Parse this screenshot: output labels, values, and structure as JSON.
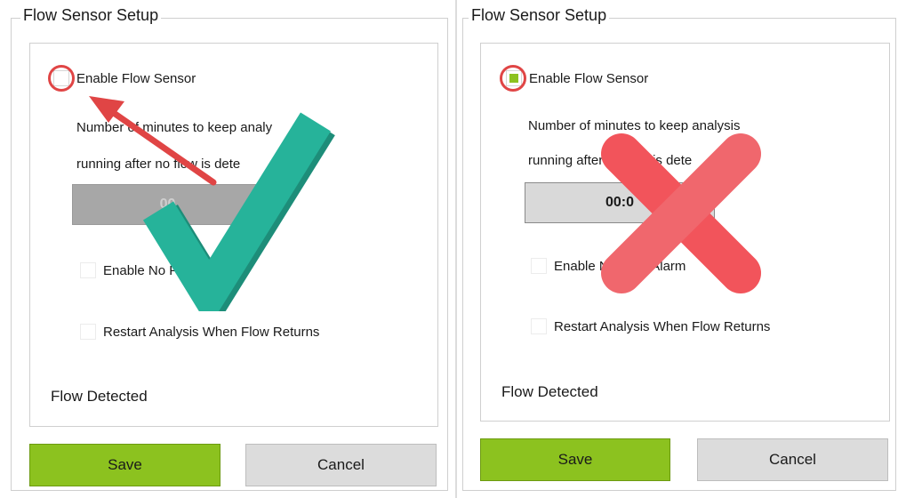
{
  "left": {
    "group_title": "Flow Sensor Setup",
    "enable_flow_sensor": {
      "label": "Enable Flow Sensor",
      "checked": false
    },
    "minutes_line1": "Number of minutes to keep analy",
    "minutes_line2": "running after no flow is dete",
    "time_value": "00",
    "enable_no_flow_alarm": {
      "label": "Enable No Flow Alarm",
      "checked": false
    },
    "restart_analysis": {
      "label": "Restart Analysis When Flow Returns",
      "checked": false
    },
    "status": "Flow Detected",
    "save_label": "Save",
    "cancel_label": "Cancel",
    "overlay_icon": "checkmark-icon"
  },
  "right": {
    "group_title": "Flow Sensor Setup",
    "enable_flow_sensor": {
      "label": "Enable Flow Sensor",
      "checked": true
    },
    "minutes_line1": "Number of minutes to keep analysis",
    "minutes_line2": "running after no flow is dete",
    "time_value": "00:0",
    "enable_no_flow_alarm": {
      "label": "Enable No Flow Alarm",
      "checked": false
    },
    "restart_analysis": {
      "label": "Restart Analysis When Flow Returns",
      "checked": false
    },
    "status": "Flow Detected",
    "save_label": "Save",
    "cancel_label": "Cancel",
    "overlay_icon": "x-mark-icon"
  },
  "colors": {
    "save_green": "#8cc21f",
    "cancel_gray": "#dcdcdc",
    "highlight_red": "#e04545",
    "check_teal": "#26b39a",
    "x_red": "#f2545b"
  }
}
